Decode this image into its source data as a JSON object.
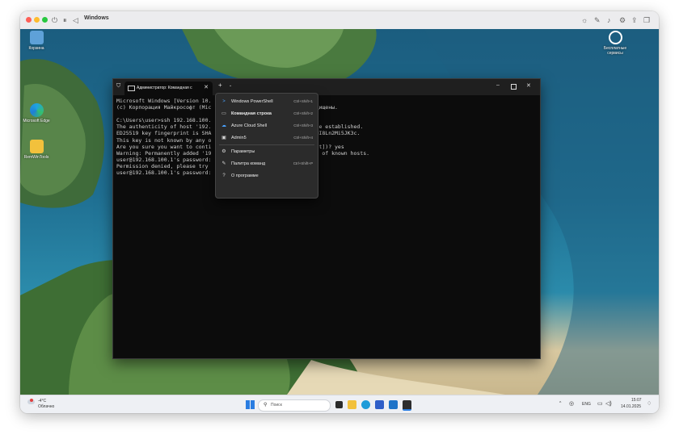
{
  "vm": {
    "title": "Windows",
    "colors": {
      "close": "#fe5f57",
      "minimize": "#febc2e",
      "zoom": "#28c840"
    },
    "toolbar_icons": [
      "power-icon",
      "pause-icon",
      "back-icon",
      "brightness-icon",
      "pen-icon",
      "audio-icon",
      "settings-icon",
      "share-icon",
      "window-icon"
    ]
  },
  "desktop": {
    "icons": [
      {
        "label": "Корзина",
        "icon": "recycle-bin-icon"
      },
      {
        "label": "Microsoft Edge",
        "icon": "edge-icon"
      },
      {
        "label": "RemWinTools",
        "icon": "folder-icon"
      },
      {
        "label": "Бесплатные сервисы",
        "icon": "user-circle-icon"
      }
    ]
  },
  "terminal": {
    "tab_label": "Администратор: Командная с",
    "lines": [
      "Microsoft Windows [Version 10.                              ",
      "(c) Корпорация Майкрософт (Mic                               защищены.",
      "",
      "C:\\Users\\user>ssh 192.168.100.",
      "The authenticity of host '192.                               t be established.",
      "ED25519 key fingerprint is SHA                              vF8MI8Ln2Mi5JK3c.",
      "This key is not known by any o",
      "Are you sure you want to conti                              print])? yes",
      "Warning: Permanently added '19                               ist of known hosts.",
      "user@192.168.100.1's password:",
      "Permission denied, please try",
      "user@192.168.100.1's password:"
    ]
  },
  "dropdown": {
    "items": [
      {
        "label": "Windows PowerShell",
        "shortcut": "Ctrl+Shift+1",
        "icon": "powershell-icon",
        "bold": false
      },
      {
        "label": "Командная строка",
        "shortcut": "Ctrl+Shift+2",
        "icon": "cmd-icon",
        "bold": true
      },
      {
        "label": "Azure Cloud Shell",
        "shortcut": "Ctrl+Shift+3",
        "icon": "azure-icon",
        "bold": false
      },
      {
        "label": "Admin5",
        "shortcut": "Ctrl+Shift+4",
        "icon": "terminal-icon",
        "bold": false
      },
      {
        "label": "Параметры",
        "shortcut": "",
        "icon": "gear-icon",
        "bold": false
      },
      {
        "label": "Палитра команд",
        "shortcut": "Ctrl+Shift+P",
        "icon": "palette-icon",
        "bold": false
      },
      {
        "label": "О программе",
        "shortcut": "",
        "icon": "help-icon",
        "bold": false
      }
    ]
  },
  "taskbar": {
    "weather_temp": "-4°C",
    "weather_desc": "Облачно",
    "search_placeholder": "Поиск",
    "lang": "ENG",
    "time": "15:07",
    "date": "14.01.2025"
  }
}
